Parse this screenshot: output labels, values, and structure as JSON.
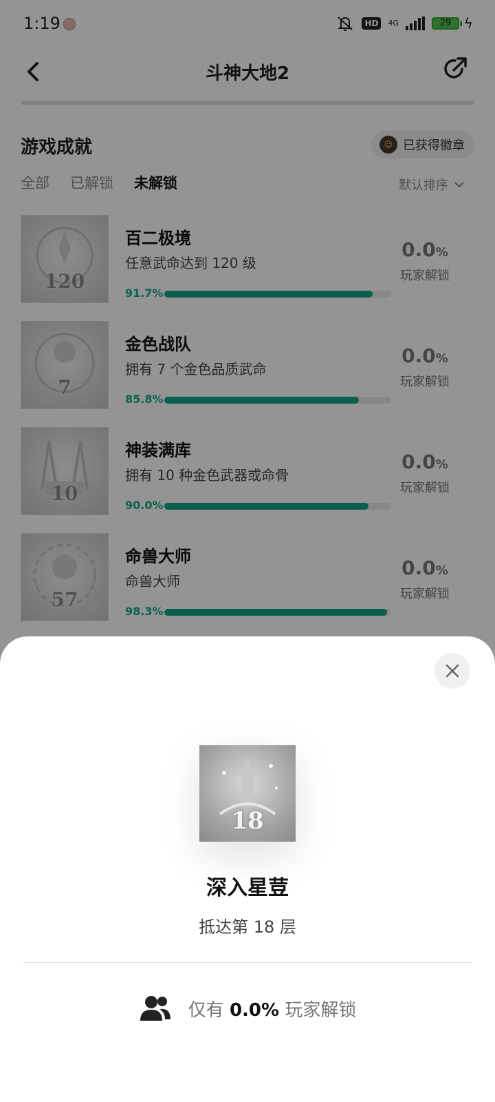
{
  "status_bar": {
    "time": "1:19",
    "hd": "HD",
    "network": "4G",
    "battery": "29"
  },
  "header": {
    "title": "斗神大地2"
  },
  "section": {
    "title": "游戏成就",
    "badge_button": "已获得徽章",
    "tabs": [
      {
        "label": "全部",
        "active": false
      },
      {
        "label": "已解锁",
        "active": false
      },
      {
        "label": "未解锁",
        "active": true
      }
    ],
    "sort_label": "默认排序"
  },
  "achievements": [
    {
      "name": "百二极境",
      "desc": "任意武命达到 120 级",
      "progress_label": "91.7%",
      "progress": 0.917,
      "rate": "0.0",
      "rate_unit": "%",
      "rate_label": "玩家解锁",
      "badge_num": "120"
    },
    {
      "name": "金色战队",
      "desc": "拥有 7 个金色品质武命",
      "progress_label": "85.8%",
      "progress": 0.858,
      "rate": "0.0",
      "rate_unit": "%",
      "rate_label": "玩家解锁",
      "badge_num": "7"
    },
    {
      "name": "神装满库",
      "desc": "拥有 10 种金色武器或命骨",
      "progress_label": "90.0%",
      "progress": 0.9,
      "rate": "0.0",
      "rate_unit": "%",
      "rate_label": "玩家解锁",
      "badge_num": "10"
    },
    {
      "name": "命兽大师",
      "desc": "命兽大师",
      "progress_label": "98.3%",
      "progress": 0.983,
      "rate": "0.0",
      "rate_unit": "%",
      "rate_label": "玩家解锁",
      "badge_num": "57"
    }
  ],
  "sheet": {
    "badge_num": "18",
    "name": "深入星荳",
    "desc": "抵达第 18 层",
    "stat_prefix": "仅有",
    "stat_value": "0.0%",
    "stat_suffix": "玩家解锁"
  },
  "colors": {
    "accent": "#12a287",
    "overlay": "rgba(0,0,0,0.42)"
  }
}
